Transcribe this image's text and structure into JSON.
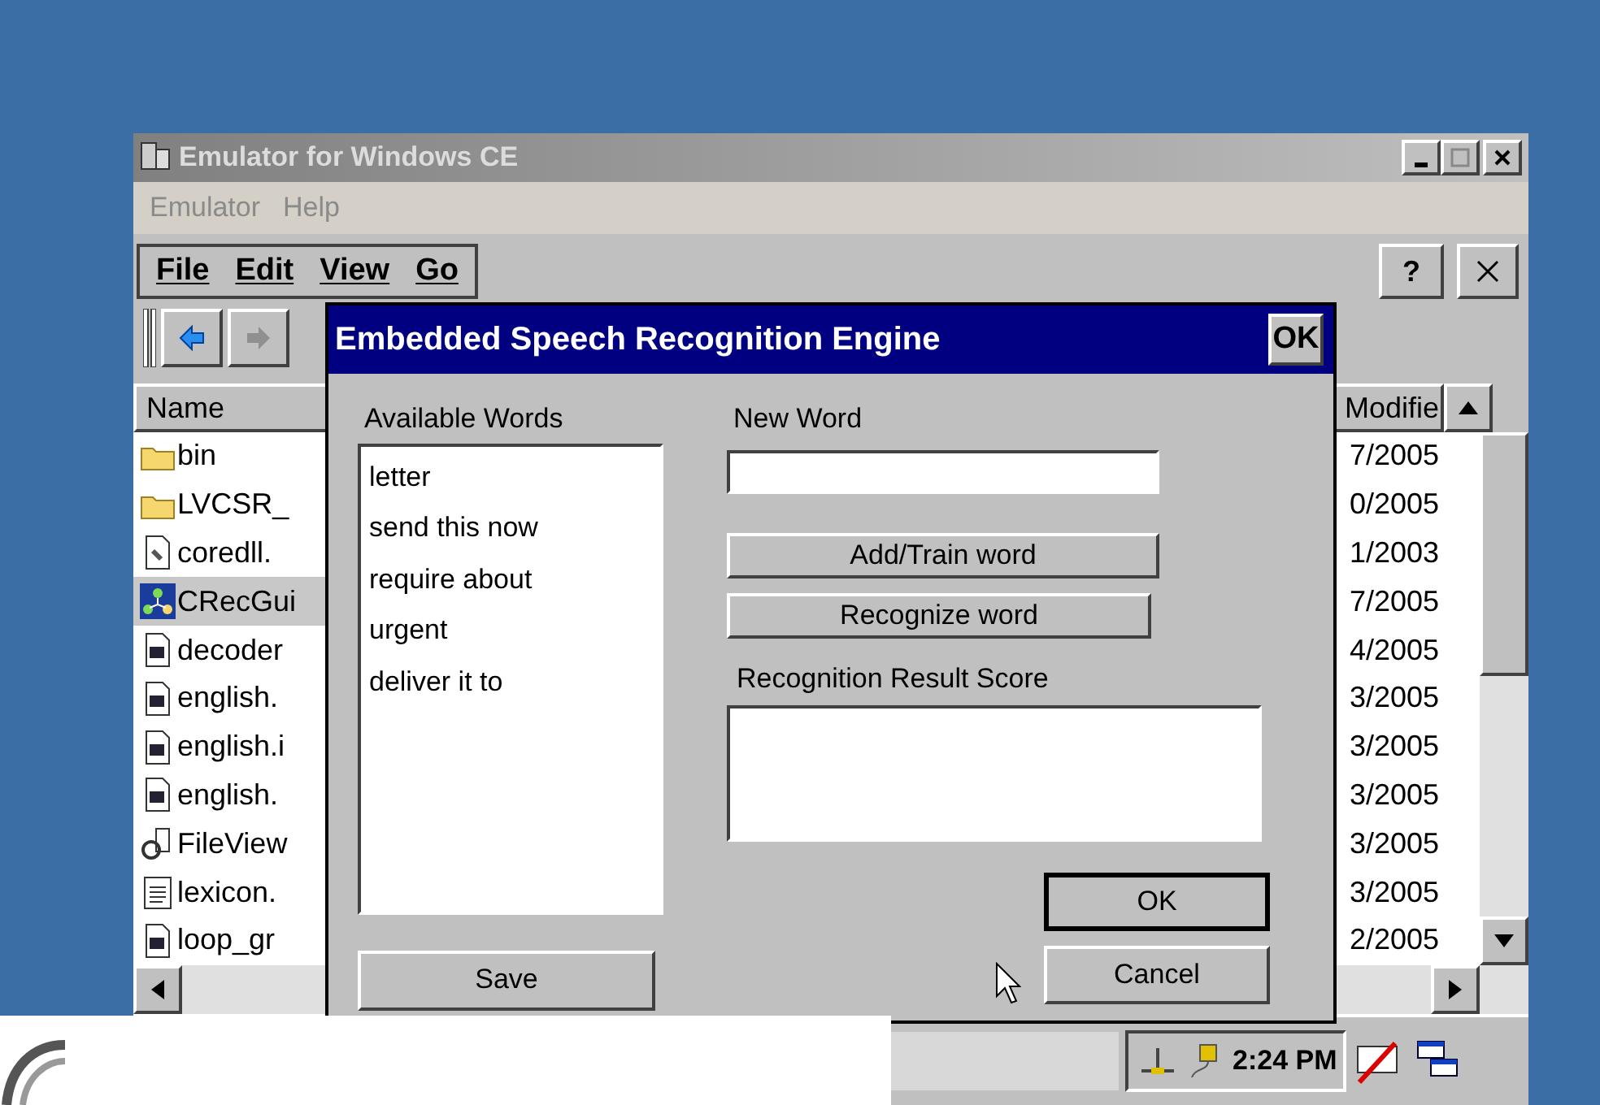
{
  "window": {
    "title": "Emulator for Windows CE",
    "menu": [
      "Emulator",
      "Help"
    ]
  },
  "command_bar": {
    "menus": [
      "File",
      "Edit",
      "View",
      "Go"
    ],
    "help": "?"
  },
  "file_list": {
    "columns": [
      "Name",
      "Modifie"
    ],
    "rows": [
      {
        "name": "bin",
        "date": "7/2005",
        "kind": "folder",
        "selected": false
      },
      {
        "name": "LVCSR_",
        "date": "0/2005",
        "kind": "folder",
        "selected": false
      },
      {
        "name": "coredll.",
        "date": "1/2003",
        "kind": "library",
        "selected": false
      },
      {
        "name": "CRecGui",
        "date": "7/2005",
        "kind": "app",
        "selected": true
      },
      {
        "name": "decoder",
        "date": "4/2005",
        "kind": "media",
        "selected": false
      },
      {
        "name": "english.",
        "date": "3/2005",
        "kind": "media",
        "selected": false
      },
      {
        "name": "english.i",
        "date": "3/2005",
        "kind": "media",
        "selected": false
      },
      {
        "name": "english.",
        "date": "3/2005",
        "kind": "media",
        "selected": false
      },
      {
        "name": "FileView",
        "date": "3/2005",
        "kind": "viewer",
        "selected": false
      },
      {
        "name": "lexicon.",
        "date": "3/2005",
        "kind": "text",
        "selected": false
      },
      {
        "name": "loop_gr",
        "date": "2/2005",
        "kind": "media",
        "selected": false
      }
    ]
  },
  "taskbar": {
    "clock": "2:24 PM"
  },
  "dialog": {
    "title": "Embedded Speech Recognition Engine",
    "title_button": "OK",
    "available_words_label": "Available Words",
    "words": [
      "letter",
      "send this now",
      "require about",
      "urgent",
      "deliver it to"
    ],
    "save": "Save",
    "new_word_label": "New Word",
    "add_train": "Add/Train word",
    "recognize": "Recognize word",
    "result_label": "Recognition Result Score",
    "ok": "OK",
    "cancel": "Cancel"
  }
}
